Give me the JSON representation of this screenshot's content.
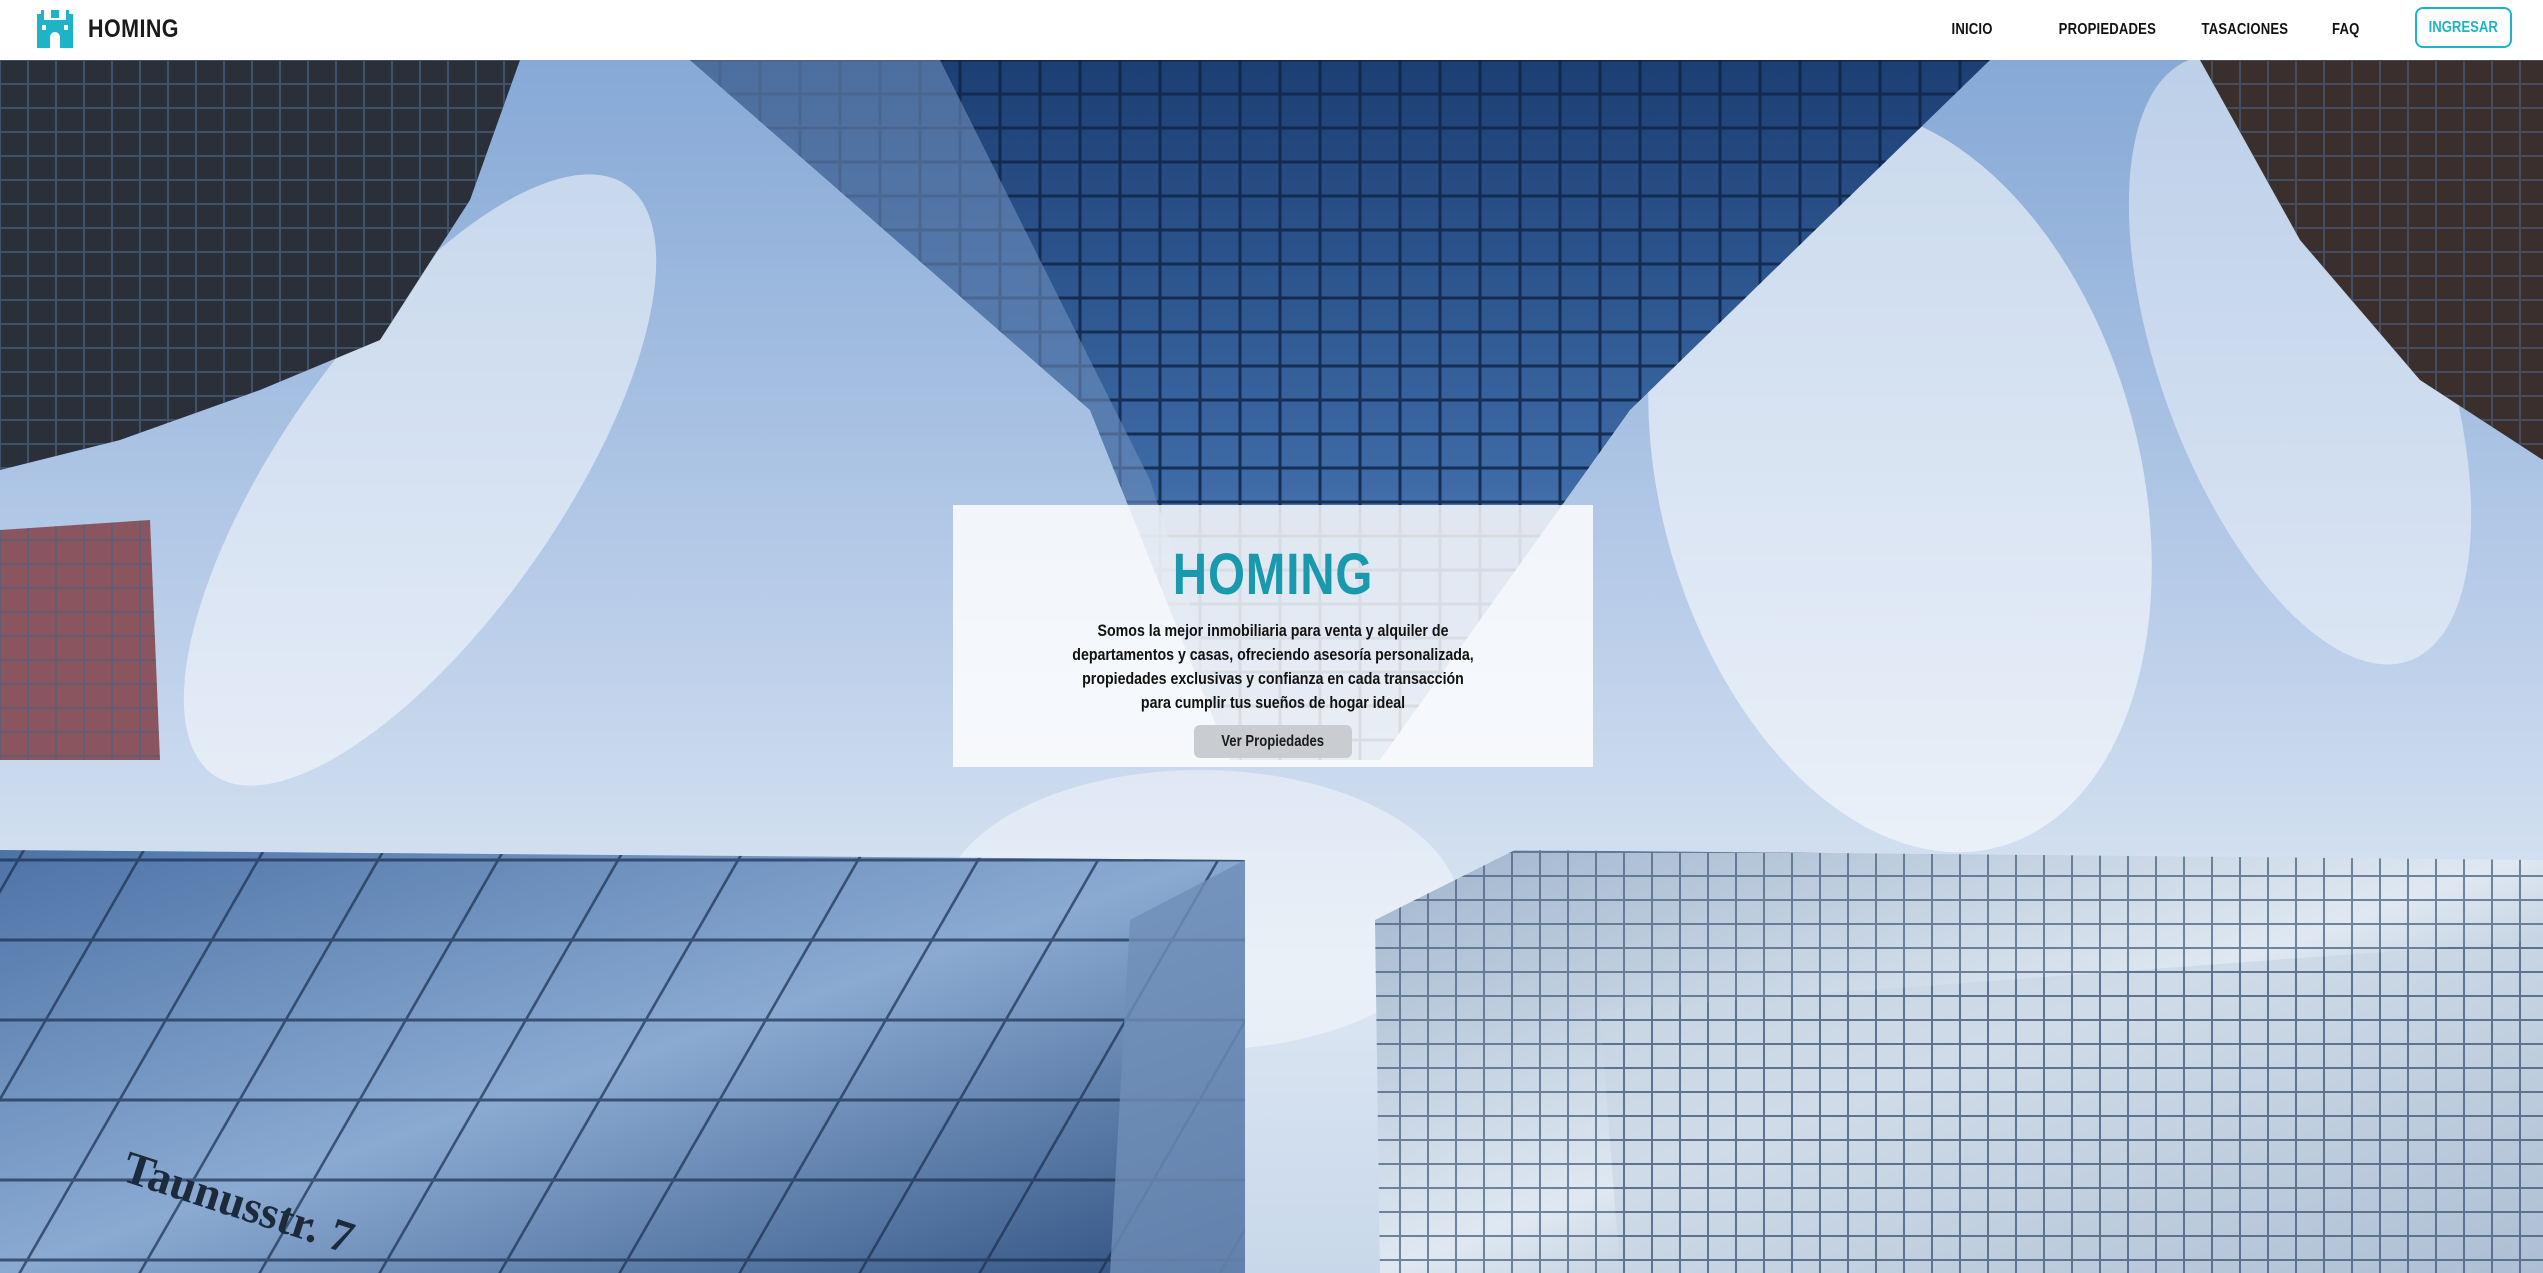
{
  "brand": {
    "name": "HOMING",
    "logo_icon": "castle-icon",
    "logo_color": "#1fb3c7"
  },
  "nav": {
    "links": [
      "INICIO",
      "PROPIEDADES",
      "TASACIONES",
      "FAQ"
    ],
    "login_label": "INGRESAR"
  },
  "hero": {
    "title": "HOMING",
    "text": "Somos la mejor inmobiliaria para venta y alquiler de departamentos y casas, ofreciendo asesoría personalizada, propiedades exclusivas y confianza en cada transacción para cumplir tus sueños de hogar ideal",
    "button_label": "Ver Propiedades",
    "background_image": "low-angle-skyscrapers-photo",
    "street_sign": "Taunusstr. 7"
  },
  "colors": {
    "accent": "#1fb3c7",
    "title": "#1899ad",
    "nav_bg": "#ffffff"
  }
}
